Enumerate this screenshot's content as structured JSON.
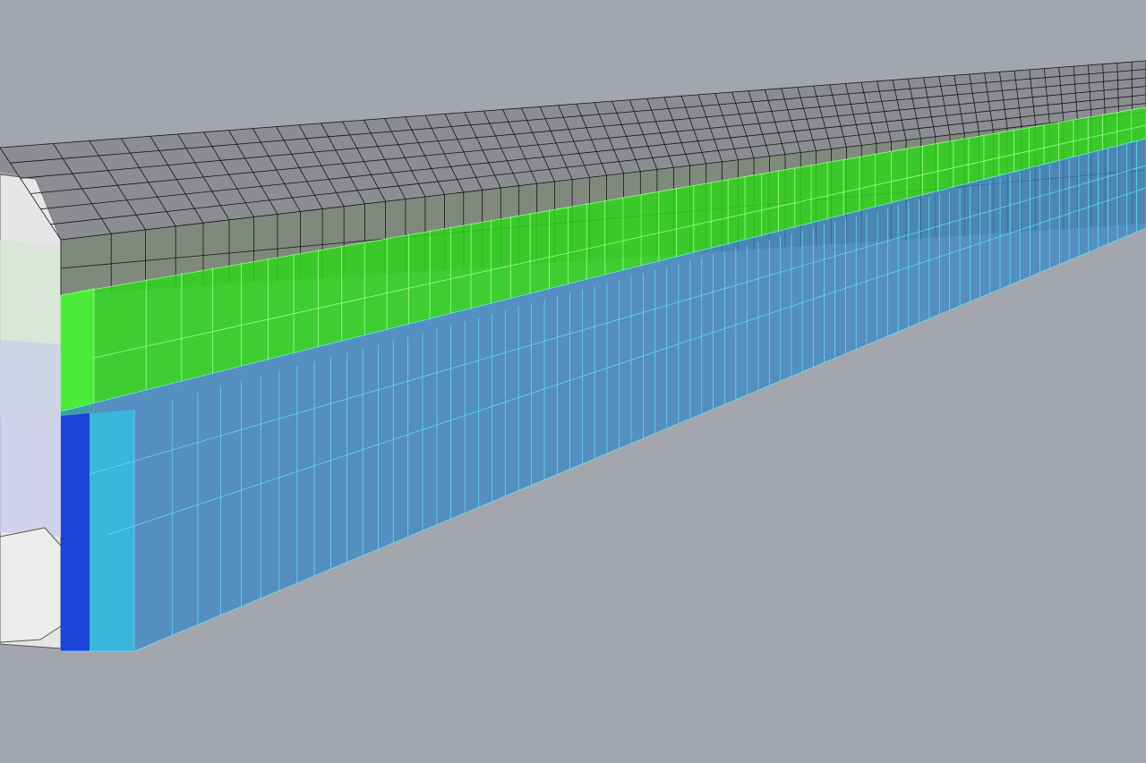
{
  "viewport": {
    "background": "#a3a6ad"
  },
  "model": {
    "layers": [
      {
        "name": "roof-canopy",
        "color": "#1a1a1a",
        "fill": "#8e9096"
      },
      {
        "name": "green-facade-band",
        "color": "#3cff2a",
        "fill": "#2fd81c"
      },
      {
        "name": "cyan-glazing-upper",
        "color": "#38e8ef",
        "fill": "#4aa8d8"
      },
      {
        "name": "cyan-glazing-lower",
        "color": "#3ad8ee",
        "fill": "#2f7fd0"
      },
      {
        "name": "blue-end-column",
        "color": "#1040e0",
        "fill": "#1a3fd8"
      },
      {
        "name": "interior-end-section",
        "color": "#5a5a5a",
        "fill": "#e4e4e6"
      }
    ]
  }
}
